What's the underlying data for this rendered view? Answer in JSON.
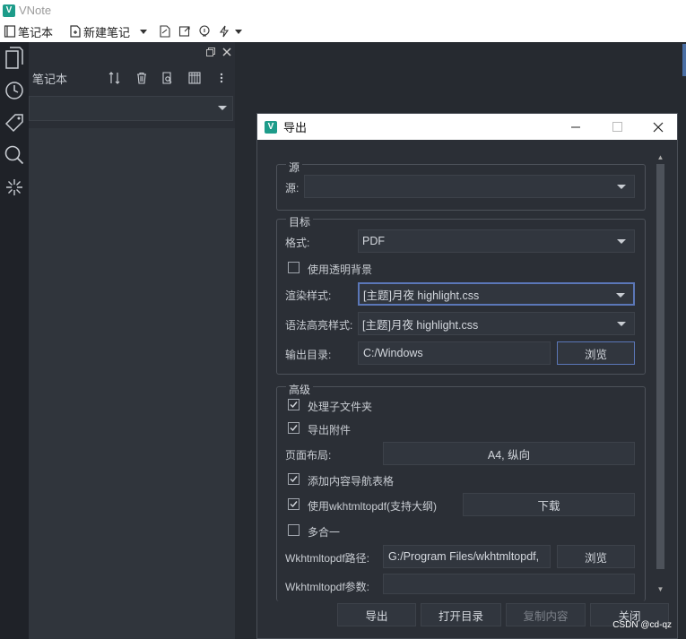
{
  "window": {
    "title": "VNote",
    "logo_letter": "V"
  },
  "menubar": {
    "notebook": "笔记本",
    "new_note": "新建笔记"
  },
  "panel": {
    "title": "笔记本"
  },
  "dialog": {
    "title": "导出",
    "source_group": {
      "title": "源",
      "label": "源:"
    },
    "target_group": {
      "title": "目标",
      "format_label": "格式:",
      "format_value": "PDF",
      "transparent_bg_label": "使用透明背景",
      "render_style_label": "渲染样式:",
      "render_style_value": "[主题]月夜 highlight.css",
      "syntax_style_label": "语法高亮样式:",
      "syntax_style_value": "[主题]月夜 highlight.css",
      "output_dir_label": "输出目录:",
      "output_dir_value": "C:/Windows",
      "browse_label": "浏览"
    },
    "advanced_group": {
      "title": "高级",
      "subfolder_label": "处理子文件夹",
      "attachments_label": "导出附件",
      "page_layout_label": "页面布局:",
      "page_layout_value": "A4, 纵向",
      "toc_label": "添加内容导航表格",
      "wkhtml_label": "使用wkhtmltopdf(支持大纲)",
      "download_label": "下载",
      "all_in_one_label": "多合一",
      "wkhtml_path_label": "Wkhtmltopdf路径:",
      "wkhtml_path_value": "G:/Program Files/wkhtmltopdf,",
      "browse_label": "浏览",
      "wkhtml_args_label": "Wkhtmltopdf参数:"
    },
    "buttons": {
      "export": "导出",
      "open_dir": "打开目录",
      "copy": "复制内容",
      "close": "关闭"
    }
  },
  "watermark": "CSDN @cd-qz"
}
